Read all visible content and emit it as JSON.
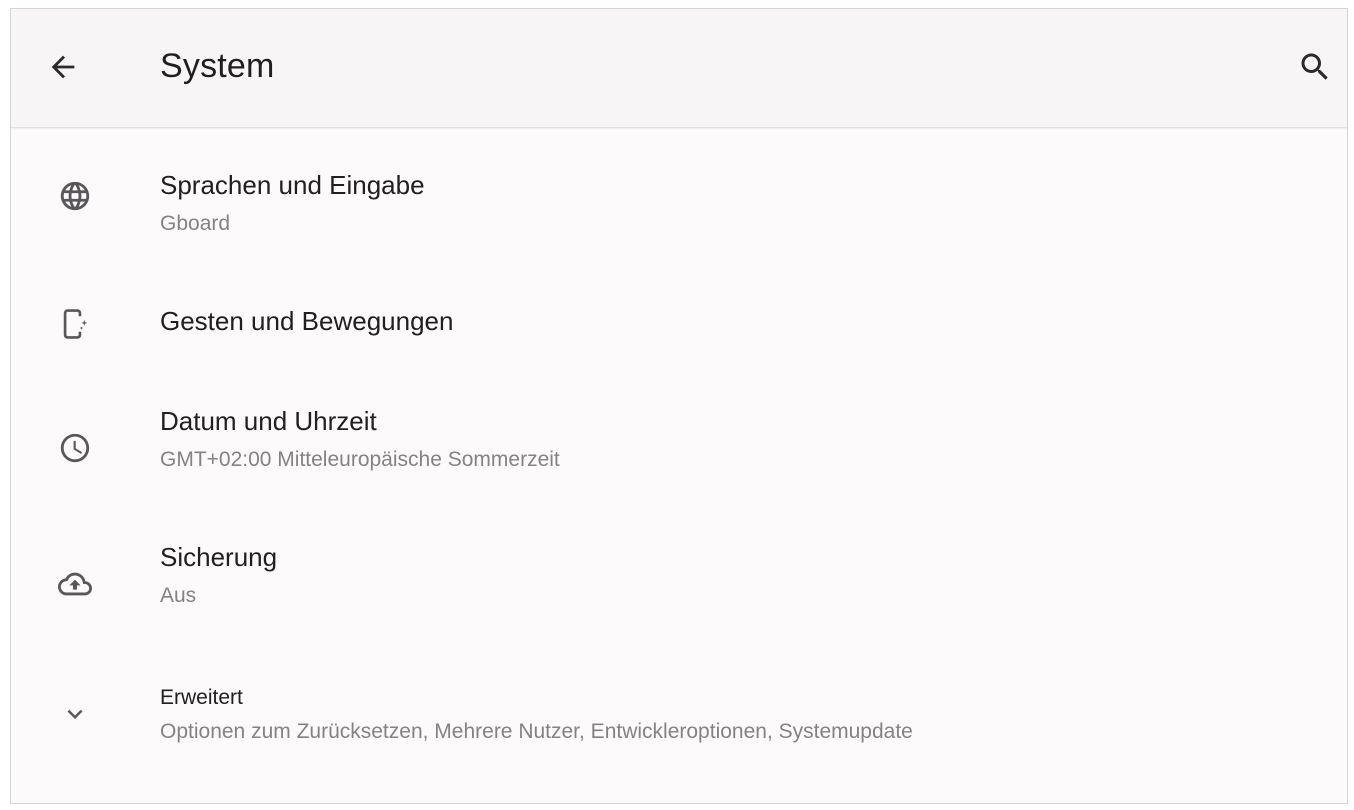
{
  "header": {
    "title": "System",
    "back_icon": "arrow-back-icon",
    "search_icon": "search-icon"
  },
  "items": [
    {
      "icon": "globe-icon",
      "title": "Sprachen und Eingabe",
      "subtitle": "Gboard"
    },
    {
      "icon": "phone-gesture-icon",
      "title": "Gesten und Bewegungen"
    },
    {
      "icon": "clock-icon",
      "title": "Datum und Uhrzeit",
      "subtitle": "GMT+02:00 Mitteleuropäische Sommerzeit"
    },
    {
      "icon": "cloud-upload-icon",
      "title": "Sicherung",
      "subtitle": "Aus"
    },
    {
      "icon": "chevron-down-icon",
      "title": "Erweitert",
      "subtitle": "Optionen zum Zurücksetzen, Mehrere Nutzer, Entwickleroptionen, Systemupdate"
    }
  ],
  "colors": {
    "background": "#fdfafb",
    "appbar": "#f7f5f6",
    "text_primary": "#202020",
    "text_secondary": "#858285",
    "icon": "#5a575a"
  }
}
